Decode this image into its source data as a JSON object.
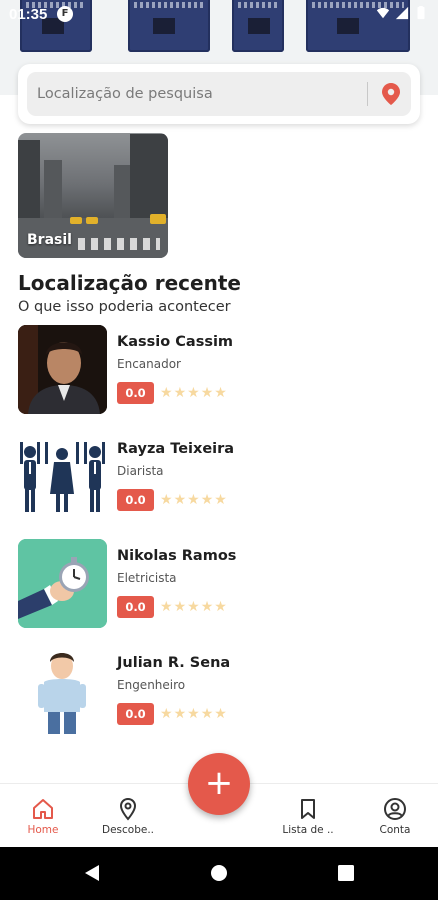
{
  "status_bar": {
    "time": "01:35",
    "app_badge": "F"
  },
  "search": {
    "placeholder": "Localização de pesquisa"
  },
  "featured_location": {
    "label": "Brasil"
  },
  "recent": {
    "title": "Localização recente",
    "subtitle": "O que isso poderia acontecer"
  },
  "professionals": [
    {
      "name": "Kassio Cassim",
      "role": "Encanador",
      "rating": "0.0",
      "stars": 5
    },
    {
      "name": "Rayza Teixeira",
      "role": "Diarista",
      "rating": "0.0",
      "stars": 5
    },
    {
      "name": "Nikolas Ramos",
      "role": "Eletricista",
      "rating": "0.0",
      "stars": 5
    },
    {
      "name": "Julian R. Sena",
      "role": "Engenheiro",
      "rating": "0.0",
      "stars": 5
    }
  ],
  "fab": {
    "label": "+"
  },
  "bottom_nav": {
    "home": "Home",
    "discover": "Descobe..",
    "list": "Lista de ..",
    "account": "Conta"
  },
  "colors": {
    "accent": "#e4594b",
    "star": "#f7d9a0",
    "search_bg": "#eeeeee"
  },
  "icons": {
    "search_action": "location-pin-icon",
    "home": "home-icon",
    "discover": "map-pin-icon",
    "list": "bookmark-icon",
    "account": "user-circle-icon"
  }
}
